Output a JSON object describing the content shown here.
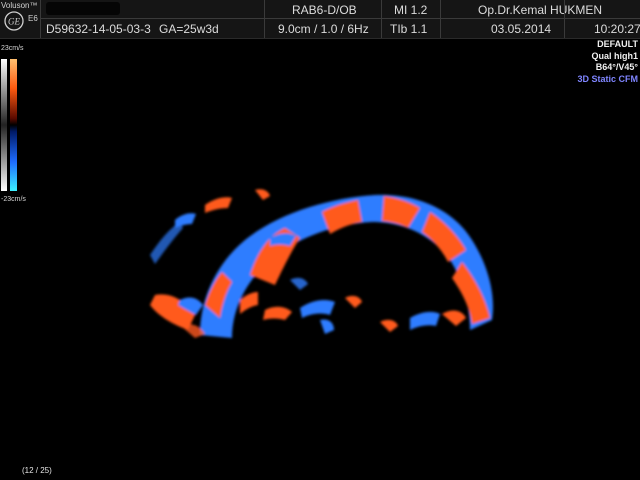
{
  "header": {
    "brand": "Voluson™",
    "model": "E6",
    "patient_id": "D59632-14-05-03-3",
    "gestational_age": "GA=25w3d",
    "probe": "RAB6-D/OB",
    "mi": "MI  1.2",
    "depth_freq": "9.0cm / 1.0 /  6Hz",
    "tib": "TIb  1.1",
    "doctor": "Op.Dr.Kemal HUKMEN",
    "date": "03.05.2014",
    "time": "10:20:27"
  },
  "velocity_scale": {
    "max_label": "23cm/s",
    "min_label": "-23cm/s"
  },
  "image_settings": {
    "preset": "DEFAULT",
    "quality": "Qual high1",
    "angle": "B64°/V45°",
    "mode": "3D Static CFM"
  },
  "frame_counter": "(12 / 25)",
  "colors": {
    "flow_toward": "#ff5a1e",
    "flow_away": "#2f7dff",
    "mode_text": "#7f85ff"
  }
}
